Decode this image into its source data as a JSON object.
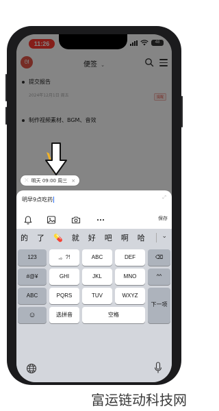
{
  "status_bar": {
    "time": "11:26",
    "battery": "48"
  },
  "header": {
    "logo_text": "ᘛ",
    "title": "便签",
    "title_caret": "⌄"
  },
  "notes": [
    {
      "title": "提交报告",
      "meta": "2024年12月1日 周五",
      "tag": "提醒"
    },
    {
      "title": "制作视频素材、BGM、音效"
    }
  ],
  "reminder_chip": {
    "icon": "⤬",
    "label": "明天 09:00 周三",
    "close": "×"
  },
  "composer": {
    "text": "明早9点吃药",
    "expand_icon": "⤢",
    "save_label": "保存"
  },
  "toolbar_icons": [
    "bell-icon",
    "image-icon",
    "camera-icon",
    "more-icon"
  ],
  "candidates": {
    "items": [
      "的",
      "了",
      "💊",
      "就",
      "好",
      "吧",
      "啊",
      "哈"
    ],
    "expand": "⌄"
  },
  "keys": {
    "k123": "123",
    "punct": ",。?!",
    "abc": "ABC",
    "def": "DEF",
    "backspace": "⌫",
    "symbols": "#@¥",
    "ghi": "GHI",
    "jkl": "JKL",
    "mno": "MNO",
    "face": "^^",
    "abc_mode": "ABC",
    "pqrs": "PQRS",
    "tuv": "TUV",
    "wxyz": "WXYZ",
    "next": "下一项",
    "emoji": "☺",
    "pinyin": "选拼音",
    "space": "空格"
  },
  "watermark": "富运链动科技网",
  "colors": {
    "accent_red": "#e25547",
    "status_pill": "#ff3b30",
    "keyboard_bg": "#d3d6dc",
    "arrow_yellow": "#f2b327"
  }
}
